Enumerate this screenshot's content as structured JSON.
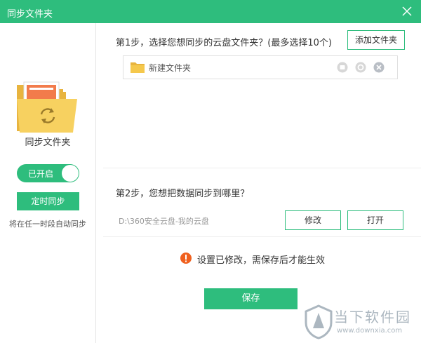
{
  "window": {
    "title": "同步文件夹"
  },
  "sidebar": {
    "title": "同步文件夹",
    "toggle_label": "已开启",
    "timed_sync_label": "定时同步",
    "hint": "将在任一时段自动同步"
  },
  "step1": {
    "text": "第1步，选择您想同步的云盘文件夹？(最多选择10个)",
    "add_button": "添加文件夹",
    "folders": [
      {
        "name": "新建文件夹"
      }
    ]
  },
  "step2": {
    "text": "第2步，您想把数据同步到哪里？",
    "path": "D:\\360安全云盘-我的云盘",
    "modify_button": "修改",
    "open_button": "打开"
  },
  "notice": "设置已修改，需保存后才能生效",
  "save_button": "保存",
  "watermark": {
    "text": "当下软件园",
    "url": "www.downxia.com"
  },
  "colors": {
    "accent": "#2ebd7d",
    "warning": "#f0611f",
    "folder": "#f5c84c"
  },
  "icons": [
    "close-icon",
    "folder-sync-icon",
    "folder-icon",
    "info-icon",
    "settings-icon",
    "remove-icon",
    "warning-icon"
  ]
}
